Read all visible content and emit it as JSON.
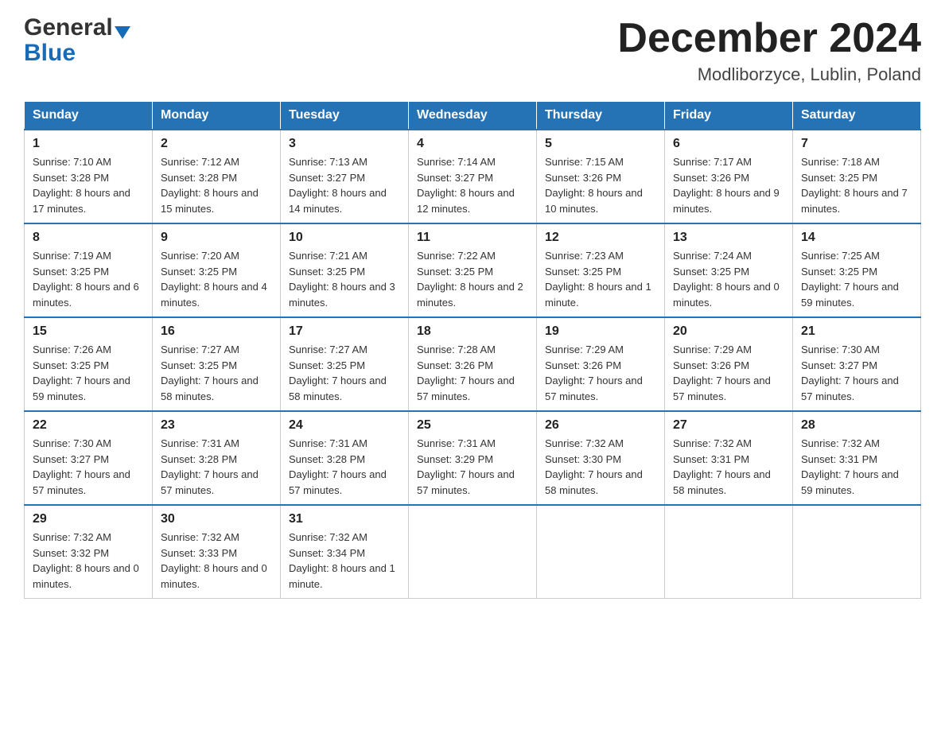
{
  "header": {
    "logo_general": "General",
    "logo_blue": "Blue",
    "month_title": "December 2024",
    "location": "Modliborzyce, Lublin, Poland"
  },
  "days_of_week": [
    "Sunday",
    "Monday",
    "Tuesday",
    "Wednesday",
    "Thursday",
    "Friday",
    "Saturday"
  ],
  "weeks": [
    [
      {
        "day": "1",
        "sunrise": "7:10 AM",
        "sunset": "3:28 PM",
        "daylight": "8 hours and 17 minutes."
      },
      {
        "day": "2",
        "sunrise": "7:12 AM",
        "sunset": "3:28 PM",
        "daylight": "8 hours and 15 minutes."
      },
      {
        "day": "3",
        "sunrise": "7:13 AM",
        "sunset": "3:27 PM",
        "daylight": "8 hours and 14 minutes."
      },
      {
        "day": "4",
        "sunrise": "7:14 AM",
        "sunset": "3:27 PM",
        "daylight": "8 hours and 12 minutes."
      },
      {
        "day": "5",
        "sunrise": "7:15 AM",
        "sunset": "3:26 PM",
        "daylight": "8 hours and 10 minutes."
      },
      {
        "day": "6",
        "sunrise": "7:17 AM",
        "sunset": "3:26 PM",
        "daylight": "8 hours and 9 minutes."
      },
      {
        "day": "7",
        "sunrise": "7:18 AM",
        "sunset": "3:25 PM",
        "daylight": "8 hours and 7 minutes."
      }
    ],
    [
      {
        "day": "8",
        "sunrise": "7:19 AM",
        "sunset": "3:25 PM",
        "daylight": "8 hours and 6 minutes."
      },
      {
        "day": "9",
        "sunrise": "7:20 AM",
        "sunset": "3:25 PM",
        "daylight": "8 hours and 4 minutes."
      },
      {
        "day": "10",
        "sunrise": "7:21 AM",
        "sunset": "3:25 PM",
        "daylight": "8 hours and 3 minutes."
      },
      {
        "day": "11",
        "sunrise": "7:22 AM",
        "sunset": "3:25 PM",
        "daylight": "8 hours and 2 minutes."
      },
      {
        "day": "12",
        "sunrise": "7:23 AM",
        "sunset": "3:25 PM",
        "daylight": "8 hours and 1 minute."
      },
      {
        "day": "13",
        "sunrise": "7:24 AM",
        "sunset": "3:25 PM",
        "daylight": "8 hours and 0 minutes."
      },
      {
        "day": "14",
        "sunrise": "7:25 AM",
        "sunset": "3:25 PM",
        "daylight": "7 hours and 59 minutes."
      }
    ],
    [
      {
        "day": "15",
        "sunrise": "7:26 AM",
        "sunset": "3:25 PM",
        "daylight": "7 hours and 59 minutes."
      },
      {
        "day": "16",
        "sunrise": "7:27 AM",
        "sunset": "3:25 PM",
        "daylight": "7 hours and 58 minutes."
      },
      {
        "day": "17",
        "sunrise": "7:27 AM",
        "sunset": "3:25 PM",
        "daylight": "7 hours and 58 minutes."
      },
      {
        "day": "18",
        "sunrise": "7:28 AM",
        "sunset": "3:26 PM",
        "daylight": "7 hours and 57 minutes."
      },
      {
        "day": "19",
        "sunrise": "7:29 AM",
        "sunset": "3:26 PM",
        "daylight": "7 hours and 57 minutes."
      },
      {
        "day": "20",
        "sunrise": "7:29 AM",
        "sunset": "3:26 PM",
        "daylight": "7 hours and 57 minutes."
      },
      {
        "day": "21",
        "sunrise": "7:30 AM",
        "sunset": "3:27 PM",
        "daylight": "7 hours and 57 minutes."
      }
    ],
    [
      {
        "day": "22",
        "sunrise": "7:30 AM",
        "sunset": "3:27 PM",
        "daylight": "7 hours and 57 minutes."
      },
      {
        "day": "23",
        "sunrise": "7:31 AM",
        "sunset": "3:28 PM",
        "daylight": "7 hours and 57 minutes."
      },
      {
        "day": "24",
        "sunrise": "7:31 AM",
        "sunset": "3:28 PM",
        "daylight": "7 hours and 57 minutes."
      },
      {
        "day": "25",
        "sunrise": "7:31 AM",
        "sunset": "3:29 PM",
        "daylight": "7 hours and 57 minutes."
      },
      {
        "day": "26",
        "sunrise": "7:32 AM",
        "sunset": "3:30 PM",
        "daylight": "7 hours and 58 minutes."
      },
      {
        "day": "27",
        "sunrise": "7:32 AM",
        "sunset": "3:31 PM",
        "daylight": "7 hours and 58 minutes."
      },
      {
        "day": "28",
        "sunrise": "7:32 AM",
        "sunset": "3:31 PM",
        "daylight": "7 hours and 59 minutes."
      }
    ],
    [
      {
        "day": "29",
        "sunrise": "7:32 AM",
        "sunset": "3:32 PM",
        "daylight": "8 hours and 0 minutes."
      },
      {
        "day": "30",
        "sunrise": "7:32 AM",
        "sunset": "3:33 PM",
        "daylight": "8 hours and 0 minutes."
      },
      {
        "day": "31",
        "sunrise": "7:32 AM",
        "sunset": "3:34 PM",
        "daylight": "8 hours and 1 minute."
      },
      null,
      null,
      null,
      null
    ]
  ]
}
